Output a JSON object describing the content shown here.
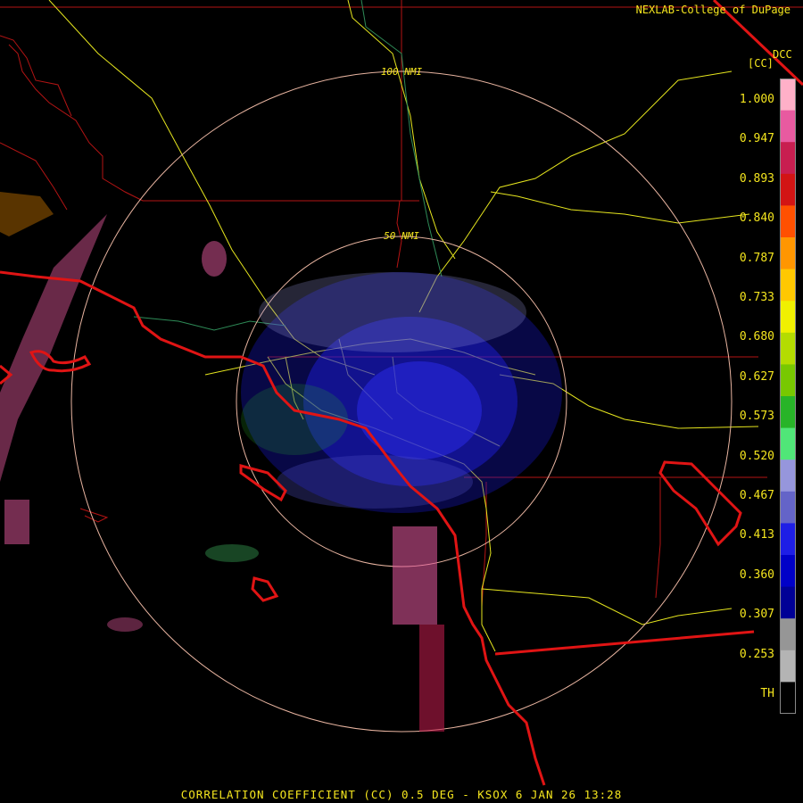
{
  "header": {
    "credit": "NEXLAB-College of DuPage",
    "product_code": "DCC",
    "units": "[CC]"
  },
  "range_rings": [
    {
      "label": "100 NMI"
    },
    {
      "label": "50 NMI"
    }
  ],
  "colorbar": {
    "tick_labels": [
      "1.000",
      "0.947",
      "0.893",
      "0.840",
      "0.787",
      "0.733",
      "0.680",
      "0.627",
      "0.573",
      "0.520",
      "0.467",
      "0.413",
      "0.360",
      "0.307",
      "0.253",
      "TH"
    ],
    "colors": [
      "#ffb0c8",
      "#e85aa0",
      "#c81e50",
      "#d21414",
      "#ff5000",
      "#ff9600",
      "#ffc800",
      "#f0f000",
      "#b4dc00",
      "#78c800",
      "#28b428",
      "#50e678",
      "#9696dc",
      "#6464c8",
      "#1e1ee6",
      "#0000c8",
      "#000096",
      "#969696",
      "#b4b4b4",
      "#000000"
    ]
  },
  "footer": {
    "caption": "CORRELATION COEFFICIENT (CC) 0.5 DEG - KSOX 6 JAN 26 13:28"
  }
}
